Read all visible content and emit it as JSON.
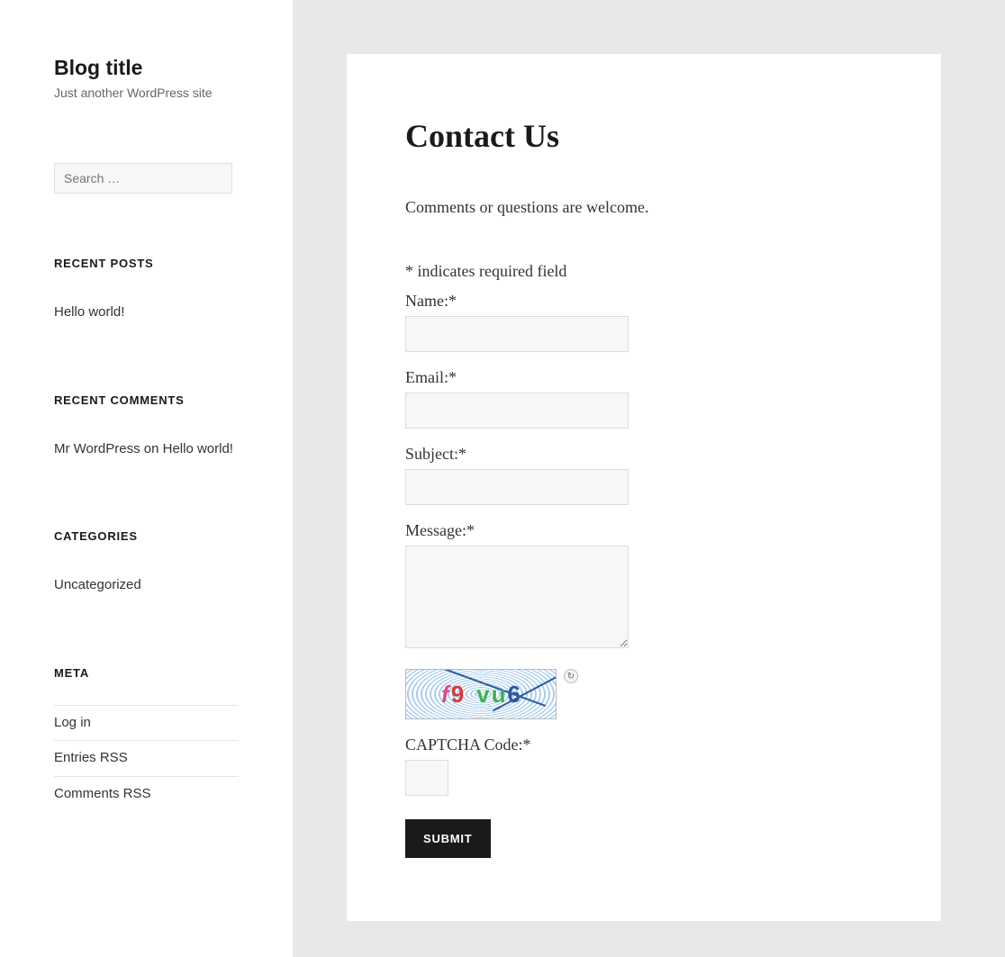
{
  "site": {
    "title": "Blog title",
    "tagline": "Just another WordPress site"
  },
  "search": {
    "placeholder": "Search …"
  },
  "widgets": {
    "recent_posts": {
      "title": "RECENT POSTS",
      "items": [
        "Hello world!"
      ]
    },
    "recent_comments": {
      "title": "RECENT COMMENTS",
      "items": [
        {
          "author": "Mr WordPress",
          "connector": " on ",
          "post": "Hello world!"
        }
      ]
    },
    "categories": {
      "title": "CATEGORIES",
      "items": [
        "Uncategorized"
      ]
    },
    "meta": {
      "title": "META",
      "items": [
        "Log in",
        "Entries RSS",
        "Comments RSS"
      ]
    }
  },
  "page": {
    "title": "Contact Us",
    "intro": "Comments or questions are welcome.",
    "required_note": "* indicates required field",
    "fields": {
      "name_label": "Name:*",
      "email_label": "Email:*",
      "subject_label": "Subject:*",
      "message_label": "Message:*",
      "captcha_label": "CAPTCHA Code:*"
    },
    "captcha_text": "f9 vu6",
    "submit_label": "SUBMIT"
  }
}
